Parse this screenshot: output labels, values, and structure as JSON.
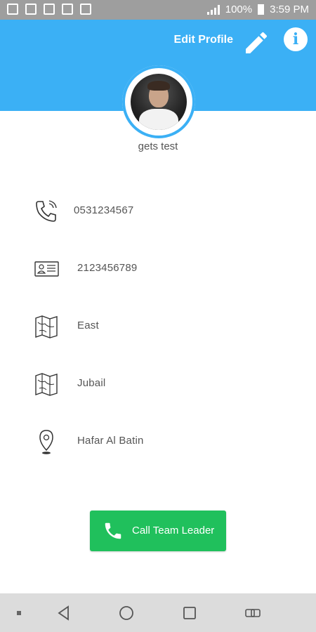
{
  "status_bar": {
    "battery": "100%",
    "time": "3:59 PM"
  },
  "header": {
    "edit_profile_label": "Edit Profile",
    "pencil_icon": "pencil-icon",
    "info_icon": "info-icon"
  },
  "profile": {
    "name": "gets test"
  },
  "details": [
    {
      "icon": "phone-icon",
      "value": "0531234567"
    },
    {
      "icon": "id-card-icon",
      "value": "2123456789"
    },
    {
      "icon": "map-icon",
      "value": "East"
    },
    {
      "icon": "map-icon",
      "value": "Jubail"
    },
    {
      "icon": "location-pin-icon",
      "value": "Hafar Al Batin"
    }
  ],
  "call_button": {
    "label": "Call Team Leader",
    "icon": "phone-icon"
  },
  "colors": {
    "header": "#3bb0f5",
    "call_button": "#20c05c"
  }
}
